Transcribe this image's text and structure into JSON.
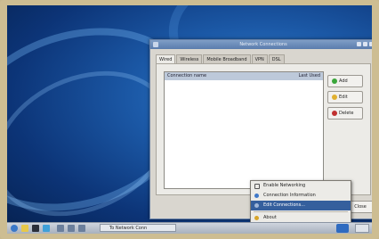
{
  "window": {
    "title": "Network Connections"
  },
  "tabs": [
    {
      "label": "Wired",
      "active": true
    },
    {
      "label": "Wireless",
      "active": false
    },
    {
      "label": "Mobile Broadband",
      "active": false
    },
    {
      "label": "VPN",
      "active": false
    },
    {
      "label": "DSL",
      "active": false
    }
  ],
  "list": {
    "col_name": "Connection name",
    "col_used": "Last Used"
  },
  "buttons": {
    "add": "Add",
    "edit": "Edit",
    "delete": "Delete",
    "close": "Close"
  },
  "menu": {
    "items": [
      {
        "label": "Enable Networking",
        "selected": false
      },
      {
        "label": "Connection Information",
        "selected": false
      },
      {
        "label": "Edit Connections...",
        "selected": true
      },
      {
        "label": "About",
        "selected": false
      }
    ]
  },
  "taskbar": {
    "task_label": "To Network Conn"
  },
  "colors": {
    "accent": "#355f9d",
    "desktop": "#1c5aa8",
    "add_icon": "#3aa63a",
    "edit_icon": "#e0b030",
    "delete_icon": "#c03030"
  }
}
